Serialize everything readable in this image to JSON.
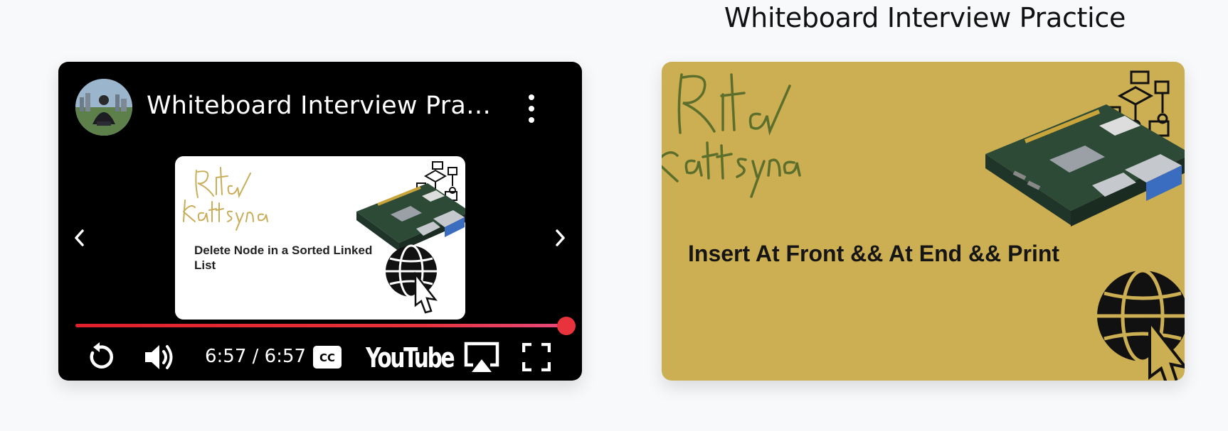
{
  "heading": "Whiteboard Interview Practice",
  "player": {
    "title": "Whiteboard Interview Practice",
    "suggestion_caption": "Delete Node in a Sorted Linked List",
    "time": "6:57 / 6:57",
    "progress_percent": 100,
    "brand": "YouTube",
    "icons": {
      "avatar": "channel-avatar",
      "menu": "more-vert-icon",
      "prev": "chevron-left-icon",
      "next": "chevron-right-icon",
      "replay": "replay-icon",
      "volume": "volume-icon",
      "captions": "closed-captions-icon",
      "airplay": "airplay-icon",
      "fullscreen": "fullscreen-icon"
    },
    "accent_color": "#e8323c"
  },
  "thumbnail": {
    "caption": "Insert At Front && At End && Print",
    "background_color": "#cbaf52"
  }
}
